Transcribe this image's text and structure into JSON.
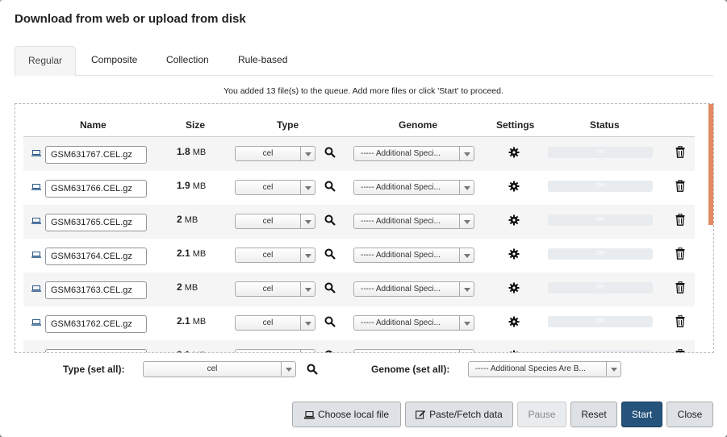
{
  "dialog": {
    "title": "Download from web or upload from disk",
    "tabs": [
      "Regular",
      "Composite",
      "Collection",
      "Rule-based"
    ],
    "active_tab": "Regular",
    "info": "You added 13 file(s) to the queue. Add more files or click 'Start' to proceed."
  },
  "table": {
    "headers": [
      "Name",
      "Size",
      "Type",
      "Genome",
      "Settings",
      "Status"
    ],
    "rows": [
      {
        "name": "GSM631767.CEL.gz",
        "size_num": "1.8",
        "size_unit": "MB",
        "type": "cel",
        "genome": "----- Additional Speci...",
        "progress": "0%"
      },
      {
        "name": "GSM631766.CEL.gz",
        "size_num": "1.9",
        "size_unit": "MB",
        "type": "cel",
        "genome": "----- Additional Speci...",
        "progress": "0%"
      },
      {
        "name": "GSM631765.CEL.gz",
        "size_num": "2",
        "size_unit": "MB",
        "type": "cel",
        "genome": "----- Additional Speci...",
        "progress": "0%"
      },
      {
        "name": "GSM631764.CEL.gz",
        "size_num": "2.1",
        "size_unit": "MB",
        "type": "cel",
        "genome": "----- Additional Speci...",
        "progress": "0%"
      },
      {
        "name": "GSM631763.CEL.gz",
        "size_num": "2",
        "size_unit": "MB",
        "type": "cel",
        "genome": "----- Additional Speci...",
        "progress": "0%"
      },
      {
        "name": "GSM631762.CEL.gz",
        "size_num": "2.1",
        "size_unit": "MB",
        "type": "cel",
        "genome": "----- Additional Speci...",
        "progress": "0%"
      }
    ]
  },
  "bulk": {
    "type_label": "Type (set all):",
    "type_value": "cel",
    "genome_label": "Genome (set all):",
    "genome_value": "----- Additional Species Are B..."
  },
  "buttons": {
    "choose_local": "Choose local file",
    "paste_fetch": "Paste/Fetch data",
    "pause": "Pause",
    "reset": "Reset",
    "start": "Start",
    "close": "Close"
  },
  "colors": {
    "primary": "#25537b",
    "scroll_accent": "#e48a62"
  }
}
